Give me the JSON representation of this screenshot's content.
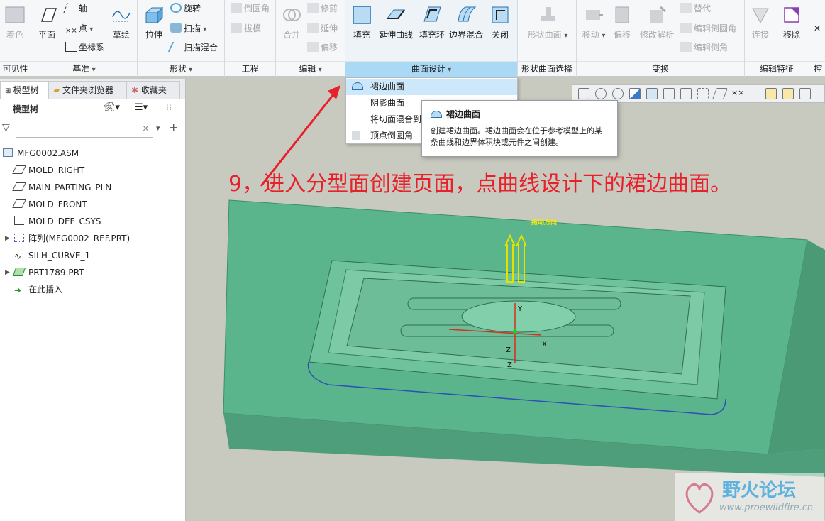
{
  "ribbon": {
    "groups": [
      {
        "label": "可见性",
        "buttons": {
          "color": "着色"
        }
      },
      {
        "label": "基准",
        "buttons": {
          "plane": "平面",
          "axis": "轴",
          "point": "点",
          "csys": "坐标系",
          "sketch": "草绘"
        }
      },
      {
        "label": "形状",
        "buttons": {
          "extrude": "拉伸",
          "revolve": "旋转",
          "sweep": "扫描",
          "swept_blend": "扫描混合"
        }
      },
      {
        "label": "工程",
        "buttons": {
          "round": "倒圆角",
          "draft": "拔模"
        }
      },
      {
        "label": "编辑",
        "buttons": {
          "merge": "合并",
          "trim": "修剪",
          "extend": "延伸",
          "offset": "偏移"
        }
      },
      {
        "label": "曲面设计",
        "buttons": {
          "fill": "填充",
          "extend_curve": "延伸曲线",
          "fill_loop": "填充环",
          "boundary_blend": "边界混合",
          "close": "关闭"
        }
      },
      {
        "label": "形状曲面选择",
        "buttons": {
          "shape_surface": "形状曲面"
        }
      },
      {
        "label": "变换",
        "buttons": {
          "move": "移动",
          "offset": "偏移",
          "modify_analysis": "修改解析",
          "replace": "替代",
          "edit_round": "编辑倒圆角",
          "edit_chamfer": "编辑倒角"
        }
      },
      {
        "label": "编辑特征",
        "buttons": {
          "attach": "连接",
          "remove": "移除"
        }
      },
      {
        "label": "控制"
      }
    ]
  },
  "panel": {
    "tabs": [
      "模型树",
      "文件夹浏览器",
      "收藏夹"
    ],
    "title": "模型树",
    "search_placeholder": "",
    "tree": [
      {
        "label": "MFG0002.ASM",
        "icon": "assembly-icon"
      },
      {
        "label": "MOLD_RIGHT",
        "icon": "datum-plane-icon"
      },
      {
        "label": "MAIN_PARTING_PLN",
        "icon": "datum-plane-icon"
      },
      {
        "label": "MOLD_FRONT",
        "icon": "datum-plane-icon"
      },
      {
        "label": "MOLD_DEF_CSYS",
        "icon": "csys-icon"
      },
      {
        "label": "阵列(MFG0002_REF.PRT)",
        "icon": "pattern-icon"
      },
      {
        "label": "SILH_CURVE_1",
        "icon": "curve-icon"
      },
      {
        "label": "PRT1789.PRT",
        "icon": "part-icon"
      },
      {
        "label": "在此插入",
        "icon": "insert-arrow-icon"
      }
    ]
  },
  "menu": {
    "items": [
      "裙边曲面",
      "阴影曲面",
      "将切面混合到",
      "顶点倒圆角"
    ]
  },
  "tooltip": {
    "title": "裙边曲面",
    "body": "创建裙边曲面。裙边曲面会在位于参考模型上的某条曲线和边界体积块或元件之间创建。"
  },
  "annotation": "9，进入分型面创建页面，点曲线设计下的裙边曲面。",
  "viewport": {
    "direction_label": "拖动方向",
    "axis_labels": [
      "Y",
      "Z",
      "X",
      "Z"
    ]
  },
  "watermark": {
    "title": "野火论坛",
    "url": "www.proewildfire.cn"
  },
  "colors": {
    "accent": "#a9d9f5",
    "model": "#55a982",
    "annotation": "#e8202a"
  }
}
